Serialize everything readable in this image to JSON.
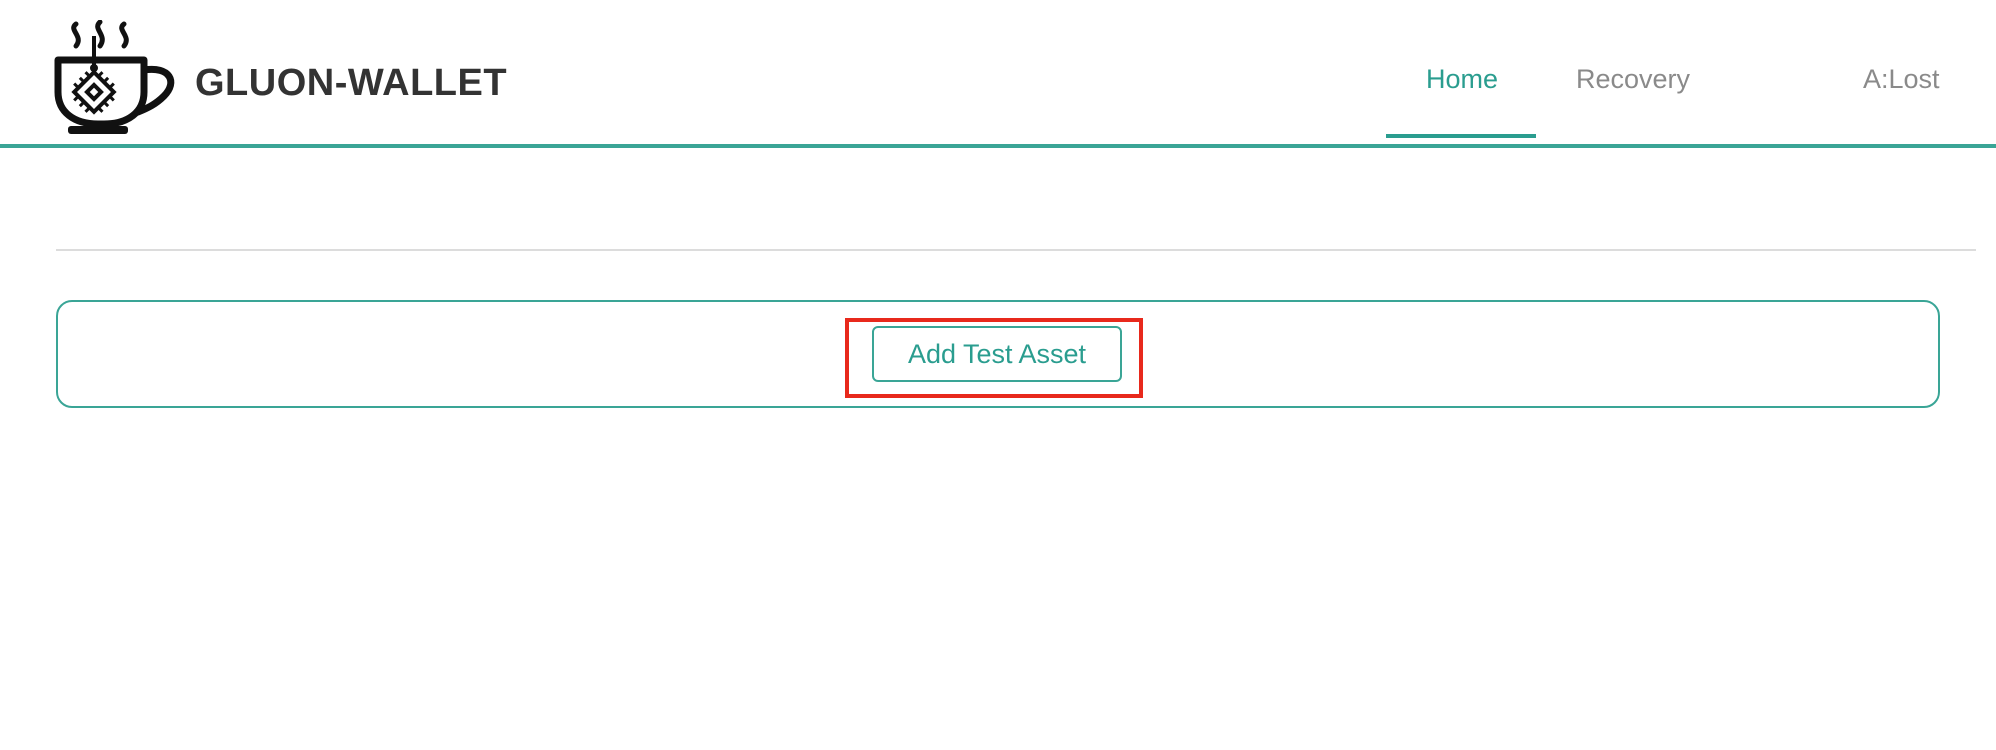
{
  "header": {
    "brand": "GLUON-WALLET",
    "logo_icon": "coffee-cup-chip-logo-icon",
    "nav": {
      "home": "Home",
      "recovery": "Recovery",
      "user": "A:Lost"
    },
    "active_tab": "Home"
  },
  "main": {
    "add_asset_label": "Add Test Asset"
  },
  "colors": {
    "accent": "#2a9d8f",
    "highlight": "#e8291c",
    "text": "#333333",
    "muted": "#8a8a8a"
  }
}
